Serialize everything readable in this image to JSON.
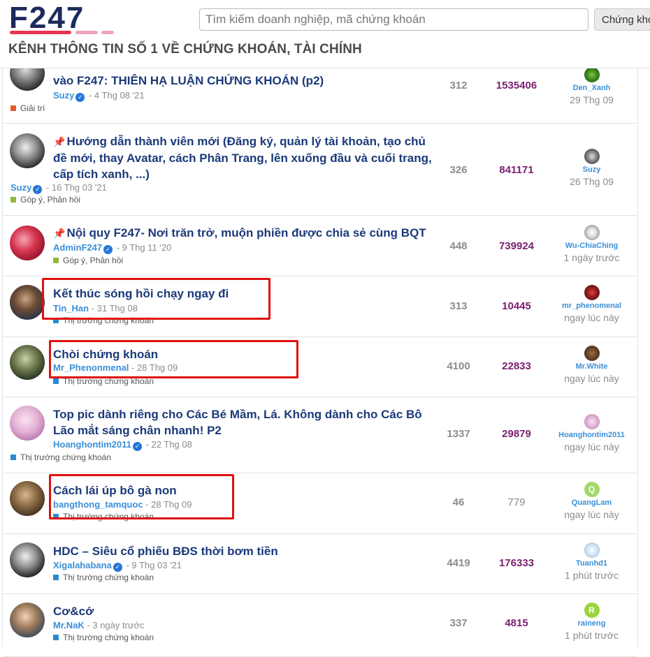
{
  "header": {
    "logo_text": "F247",
    "tagline": "KÊNH THÔNG TIN SỐ 1 VỀ CHỨNG KHOÁN, TÀI CHÍNH",
    "search_placeholder": "Tìm kiếm doanh nghiệp, mã chứng khoán",
    "search_button": "Chứng khoán"
  },
  "topics": [
    {
      "title": "vào F247: THIÊN HẠ LUẬN CHỨNG KHOÁN (p2)",
      "title_prefix": "",
      "author": "Suzy",
      "date": "- 4 Thg 08 '21",
      "forum": "Giải trí",
      "forum_color": "#e9592b",
      "replies": "312",
      "views": "1535406",
      "last_user": "Den_Xanh",
      "last_time": "29 Thg 09"
    },
    {
      "title": "Hướng dẫn thành viên mới (Đăng ký, quản lý tài khoản, tạo chủ đề mới, thay Avatar, cách Phân Trang, lên xuống đầu và cuối trang, cấp tích xanh, ...)",
      "author": "Suzy",
      "date": "- 16 Thg 03 '21",
      "forum": "Góp ý, Phản hồi",
      "forum_color": "#92b938",
      "replies": "326",
      "views": "841171",
      "last_user": "Suzy",
      "last_time": "26 Thg 09"
    },
    {
      "title": "Nội quy F247- Nơi trăn trở, muộn phiền được chia sẻ cùng BQT",
      "author": "AdminF247",
      "date": "- 9 Thg 11 '20",
      "forum": "Góp ý, Phản hồi",
      "forum_color": "#92b938",
      "replies": "448",
      "views": "739924",
      "last_user": "Wu-ChiaChing",
      "last_time": "1 ngày trước"
    },
    {
      "title": "Kết thúc sóng hồi chạy ngay đi",
      "author": "Tin_Han",
      "date": "- 31 Thg 08",
      "forum": "Thị trường chứng khoán",
      "forum_color": "#2a8bd0",
      "replies": "313",
      "views": "10445",
      "last_user": "mr_phenomenal",
      "last_time": "ngay lúc này"
    },
    {
      "title": "Chòi chứng khoán",
      "author": "Mr_Phenonmenal",
      "date": "- 28 Thg 09",
      "forum": "Thị trường chứng khoán",
      "forum_color": "#2a8bd0",
      "replies": "4100",
      "views": "22833",
      "last_user": "Mr.White",
      "last_time": "ngay lúc này"
    },
    {
      "title": "Top pic dành riêng cho Các Bé Mầm, Lá. Không dành cho Các Bô Lão mắt sáng chân nhanh! P2",
      "author": "Hoanghontim2011",
      "date": "- 22 Thg 08",
      "forum": "Thị trường chứng khoán",
      "forum_color": "#2a8bd0",
      "replies": "1337",
      "views": "29879",
      "last_user": "Hoanghontim2011",
      "last_time": "ngay lúc này"
    },
    {
      "title": "Cách lái úp bô gà non",
      "author": "bangthong_tamquoc",
      "date": "- 28 Thg 09",
      "forum": "Thị trường chứng khoán",
      "forum_color": "#2a8bd0",
      "replies": "46",
      "views": "779",
      "last_user": "QuangLam",
      "last_time": "ngay lúc này"
    },
    {
      "title": "HDC – Siêu cổ phiếu BĐS thời bơm tiền",
      "author": "Xigalahabana",
      "date": "- 9 Thg 03 '21",
      "forum": "Thị trường chứng khoán",
      "forum_color": "#2a8bd0",
      "replies": "4419",
      "views": "176333",
      "last_user": "Tuanhd1",
      "last_time": "1 phút trước"
    },
    {
      "title": "Cơ&cớ",
      "author": "Mr.NaK",
      "date": "- 3 ngày trước",
      "forum": "Thị trường chứng khoán",
      "forum_color": "#2a8bd0",
      "replies": "337",
      "views": "4815",
      "last_user": "raineng",
      "last_time": "1 phút trước"
    }
  ],
  "letters": {
    "quanglam": "Q",
    "raineng": "R"
  },
  "verified_mark": "✓",
  "pin_mark": "📌"
}
